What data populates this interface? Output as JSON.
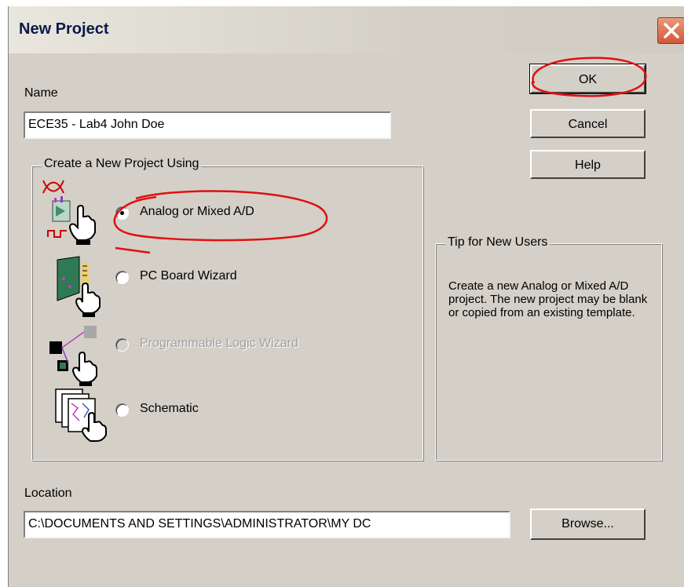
{
  "window": {
    "title": "New Project",
    "close_symbol": "✕"
  },
  "name_field": {
    "label": "Name",
    "value": "ECE35 - Lab4 John Doe"
  },
  "buttons": {
    "ok": "OK",
    "cancel": "Cancel",
    "help": "Help",
    "browse": "Browse..."
  },
  "create_group": {
    "legend": "Create a New Project Using",
    "options": [
      {
        "label": "Analog or Mixed A/D",
        "selected": true,
        "enabled": true,
        "icon": "analog-circuit-icon"
      },
      {
        "label": "PC Board Wizard",
        "selected": false,
        "enabled": true,
        "icon": "pc-board-icon"
      },
      {
        "label": "Programmable Logic Wizard",
        "selected": false,
        "enabled": false,
        "icon": "programmable-logic-icon"
      },
      {
        "label": "Schematic",
        "selected": false,
        "enabled": true,
        "icon": "schematic-icon"
      }
    ]
  },
  "tip_group": {
    "legend": "Tip for New Users",
    "text": "Create a new Analog or Mixed A/D project.  The new project may be blank or copied from an existing template."
  },
  "location_field": {
    "label": "Location",
    "value": "C:\\DOCUMENTS AND SETTINGS\\ADMINISTRATOR\\MY DC"
  },
  "colors": {
    "dialog_background": "#d4d0c8",
    "annotation_red": "#e01010",
    "close_button": "#d3563b"
  }
}
